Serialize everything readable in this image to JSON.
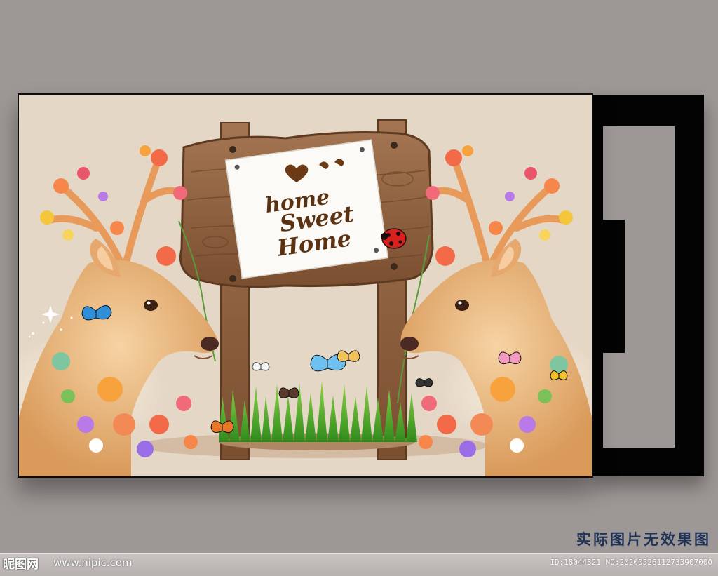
{
  "sign": {
    "line1": "home",
    "line2": "Sweet",
    "line3": "Home"
  },
  "caption": {
    "note": "实际图片无效果图"
  },
  "watermark": {
    "logo_text": "昵图网",
    "url": "www.nipic.com",
    "id_text": "ID:18044321 NO:20200526112733907000"
  },
  "colors": {
    "wall": "#9d9795",
    "mural_background": "#e5d7c6",
    "frame": "#030303",
    "wood": "#8b5d3b",
    "grass": "#4fb02c",
    "caption_text": "#1f3358"
  },
  "icons": [
    "heart-icon",
    "bird-icon",
    "ladybug-icon",
    "butterfly-icon",
    "deer-illustration",
    "flower-cluster",
    "sparkle-icon"
  ]
}
